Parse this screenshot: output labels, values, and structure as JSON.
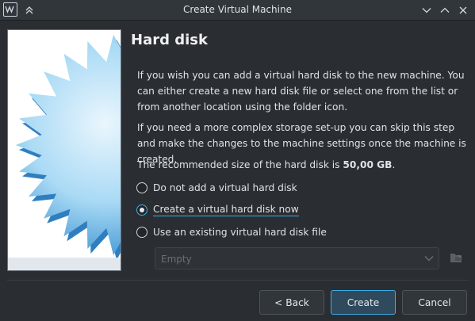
{
  "window": {
    "title": "Create Virtual Machine"
  },
  "page": {
    "title": "Hard disk",
    "paragraph1": "If you wish you can add a virtual hard disk to the new machine. You can either create a new hard disk file or select one from the list or from another location using the folder icon.",
    "paragraph2": "If you need a more complex storage set-up you can skip this step and make the changes to the machine settings once the machine is created.",
    "recommended_prefix": "The recommended size of the hard disk is ",
    "recommended_size": "50,00 GB",
    "recommended_suffix": "."
  },
  "options": [
    {
      "label": "Do not add a virtual hard disk",
      "selected": false
    },
    {
      "label": "Create a virtual hard disk now",
      "selected": true
    },
    {
      "label": "Use an existing virtual hard disk file",
      "selected": false
    }
  ],
  "existing_disk": {
    "value": "Empty"
  },
  "buttons": {
    "back": "< Back",
    "create": "Create",
    "cancel": "Cancel"
  },
  "colors": {
    "accent": "#3daee9",
    "window_bg": "#2a2e32",
    "titlebar_bg": "#31363b"
  },
  "icons": {
    "app": "virtualbox-app-icon",
    "keep_above": "keep-above-icon",
    "minimize": "chevron-down-icon",
    "maximize": "chevron-up-icon",
    "close": "close-icon",
    "combo_arrow": "chevron-down-icon",
    "folder": "folder-icon"
  }
}
